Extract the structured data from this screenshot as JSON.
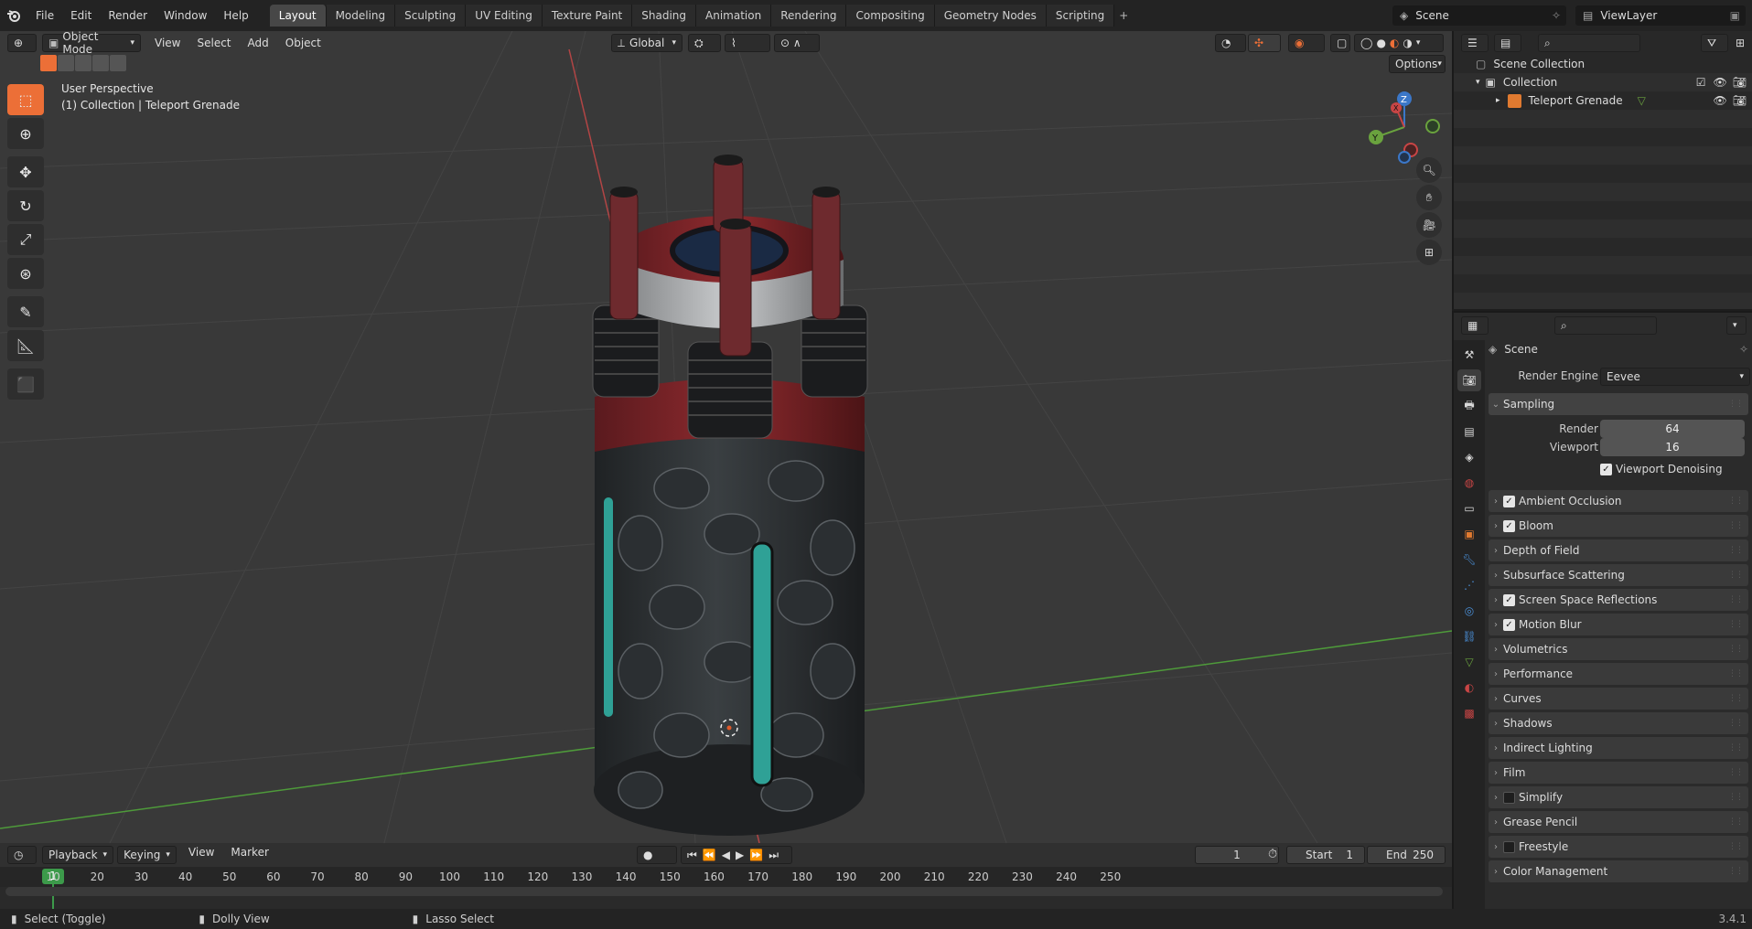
{
  "topbar": {
    "menus": [
      "File",
      "Edit",
      "Render",
      "Window",
      "Help"
    ],
    "workspaces": [
      "Layout",
      "Modeling",
      "Sculpting",
      "UV Editing",
      "Texture Paint",
      "Shading",
      "Animation",
      "Rendering",
      "Compositing",
      "Geometry Nodes",
      "Scripting"
    ],
    "active_workspace": "Layout",
    "add_tab": "+",
    "scene_name": "Scene",
    "view_layer": "ViewLayer"
  },
  "viewport": {
    "mode": "Object Mode",
    "menus": [
      "View",
      "Select",
      "Add",
      "Object"
    ],
    "orientation": "Global",
    "options_label": "Options",
    "info_line1": "User Perspective",
    "info_line2": "(1) Collection | Teleport Grenade",
    "gizmo": {
      "x": "X",
      "y": "Y",
      "z": "Z"
    },
    "tools": [
      "select-box-icon",
      "cursor-icon",
      "move-icon",
      "rotate-icon",
      "scale-icon",
      "transform-icon",
      "annotate-icon",
      "measure-icon",
      "add-cube-icon"
    ],
    "colors": {
      "background": "#393939",
      "x_axis": "#b24545",
      "y_axis": "#4e9a3a",
      "accent": "#ec6f37"
    }
  },
  "timeline": {
    "menus": [
      "Playback",
      "Keying",
      "View",
      "Marker"
    ],
    "current_frame": "1",
    "start_label": "Start",
    "start_value": "1",
    "end_label": "End",
    "end_value": "250",
    "ticks": [
      "10",
      "20",
      "30",
      "40",
      "50",
      "60",
      "70",
      "80",
      "90",
      "100",
      "110",
      "120",
      "130",
      "140",
      "150",
      "160",
      "170",
      "180",
      "190",
      "200",
      "210",
      "220",
      "230",
      "240",
      "250"
    ]
  },
  "statusbar": {
    "select": "Select (Toggle)",
    "dolly": "Dolly View",
    "lasso": "Lasso Select",
    "version": "3.4.1"
  },
  "outliner": {
    "root": "Scene Collection",
    "collection": "Collection",
    "object": "Teleport Grenade"
  },
  "properties": {
    "context": "Scene",
    "render_engine_label": "Render Engine",
    "render_engine": "Eevee",
    "sampling": {
      "title": "Sampling",
      "render_label": "Render",
      "render_value": "64",
      "viewport_label": "Viewport",
      "viewport_value": "16",
      "denoise_label": "Viewport Denoising",
      "denoise_checked": true
    },
    "panels": [
      {
        "label": "Ambient Occlusion",
        "checkbox": true,
        "checked": true
      },
      {
        "label": "Bloom",
        "checkbox": true,
        "checked": true
      },
      {
        "label": "Depth of Field",
        "checkbox": false
      },
      {
        "label": "Subsurface Scattering",
        "checkbox": false
      },
      {
        "label": "Screen Space Reflections",
        "checkbox": true,
        "checked": true
      },
      {
        "label": "Motion Blur",
        "checkbox": true,
        "checked": true
      },
      {
        "label": "Volumetrics",
        "checkbox": false
      },
      {
        "label": "Performance",
        "checkbox": false
      },
      {
        "label": "Curves",
        "checkbox": false
      },
      {
        "label": "Shadows",
        "checkbox": false
      },
      {
        "label": "Indirect Lighting",
        "checkbox": false
      },
      {
        "label": "Film",
        "checkbox": false
      },
      {
        "label": "Simplify",
        "checkbox": true,
        "checked": false
      },
      {
        "label": "Grease Pencil",
        "checkbox": false
      },
      {
        "label": "Freestyle",
        "checkbox": true,
        "checked": false
      },
      {
        "label": "Color Management",
        "checkbox": false
      }
    ]
  }
}
